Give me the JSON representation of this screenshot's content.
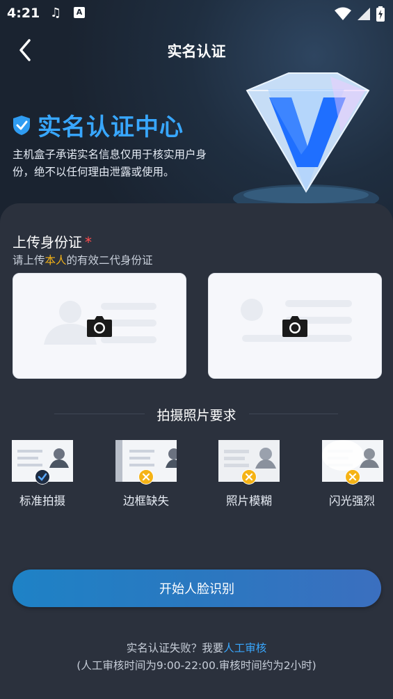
{
  "status_bar": {
    "time": "4:21",
    "icons": [
      "music-note-icon",
      "a-icon",
      "wifi-icon",
      "signal-icon",
      "battery-icon"
    ]
  },
  "header": {
    "title": "实名认证",
    "back_icon": "chevron-left-icon"
  },
  "hero": {
    "title": "实名认证中心",
    "description": "主机盒子承诺实名信息仅用于核实用户身份，绝不以任何理由泄露或使用。",
    "accent_color": "#38a7ff"
  },
  "upload": {
    "title": "上传身份证",
    "required_mark": "*",
    "subtitle_prefix": "请上传",
    "subtitle_highlight": "本人",
    "subtitle_suffix": "的有效二代身份证",
    "camera_icon": "camera-icon"
  },
  "requirements": {
    "title": "拍摄照片要求",
    "items": [
      {
        "label": "标准拍摄",
        "status": "ok"
      },
      {
        "label": "边框缺失",
        "status": "bad"
      },
      {
        "label": "照片模糊",
        "status": "bad"
      },
      {
        "label": "闪光强烈",
        "status": "bad"
      }
    ]
  },
  "cta": {
    "label": "开始人脸识别"
  },
  "footer": {
    "fail_text": "实名认证失败？我要",
    "fail_link": "人工审核",
    "hours_text": "(人工审核时间为9:00-22:00.审核时间约为2小时)"
  }
}
